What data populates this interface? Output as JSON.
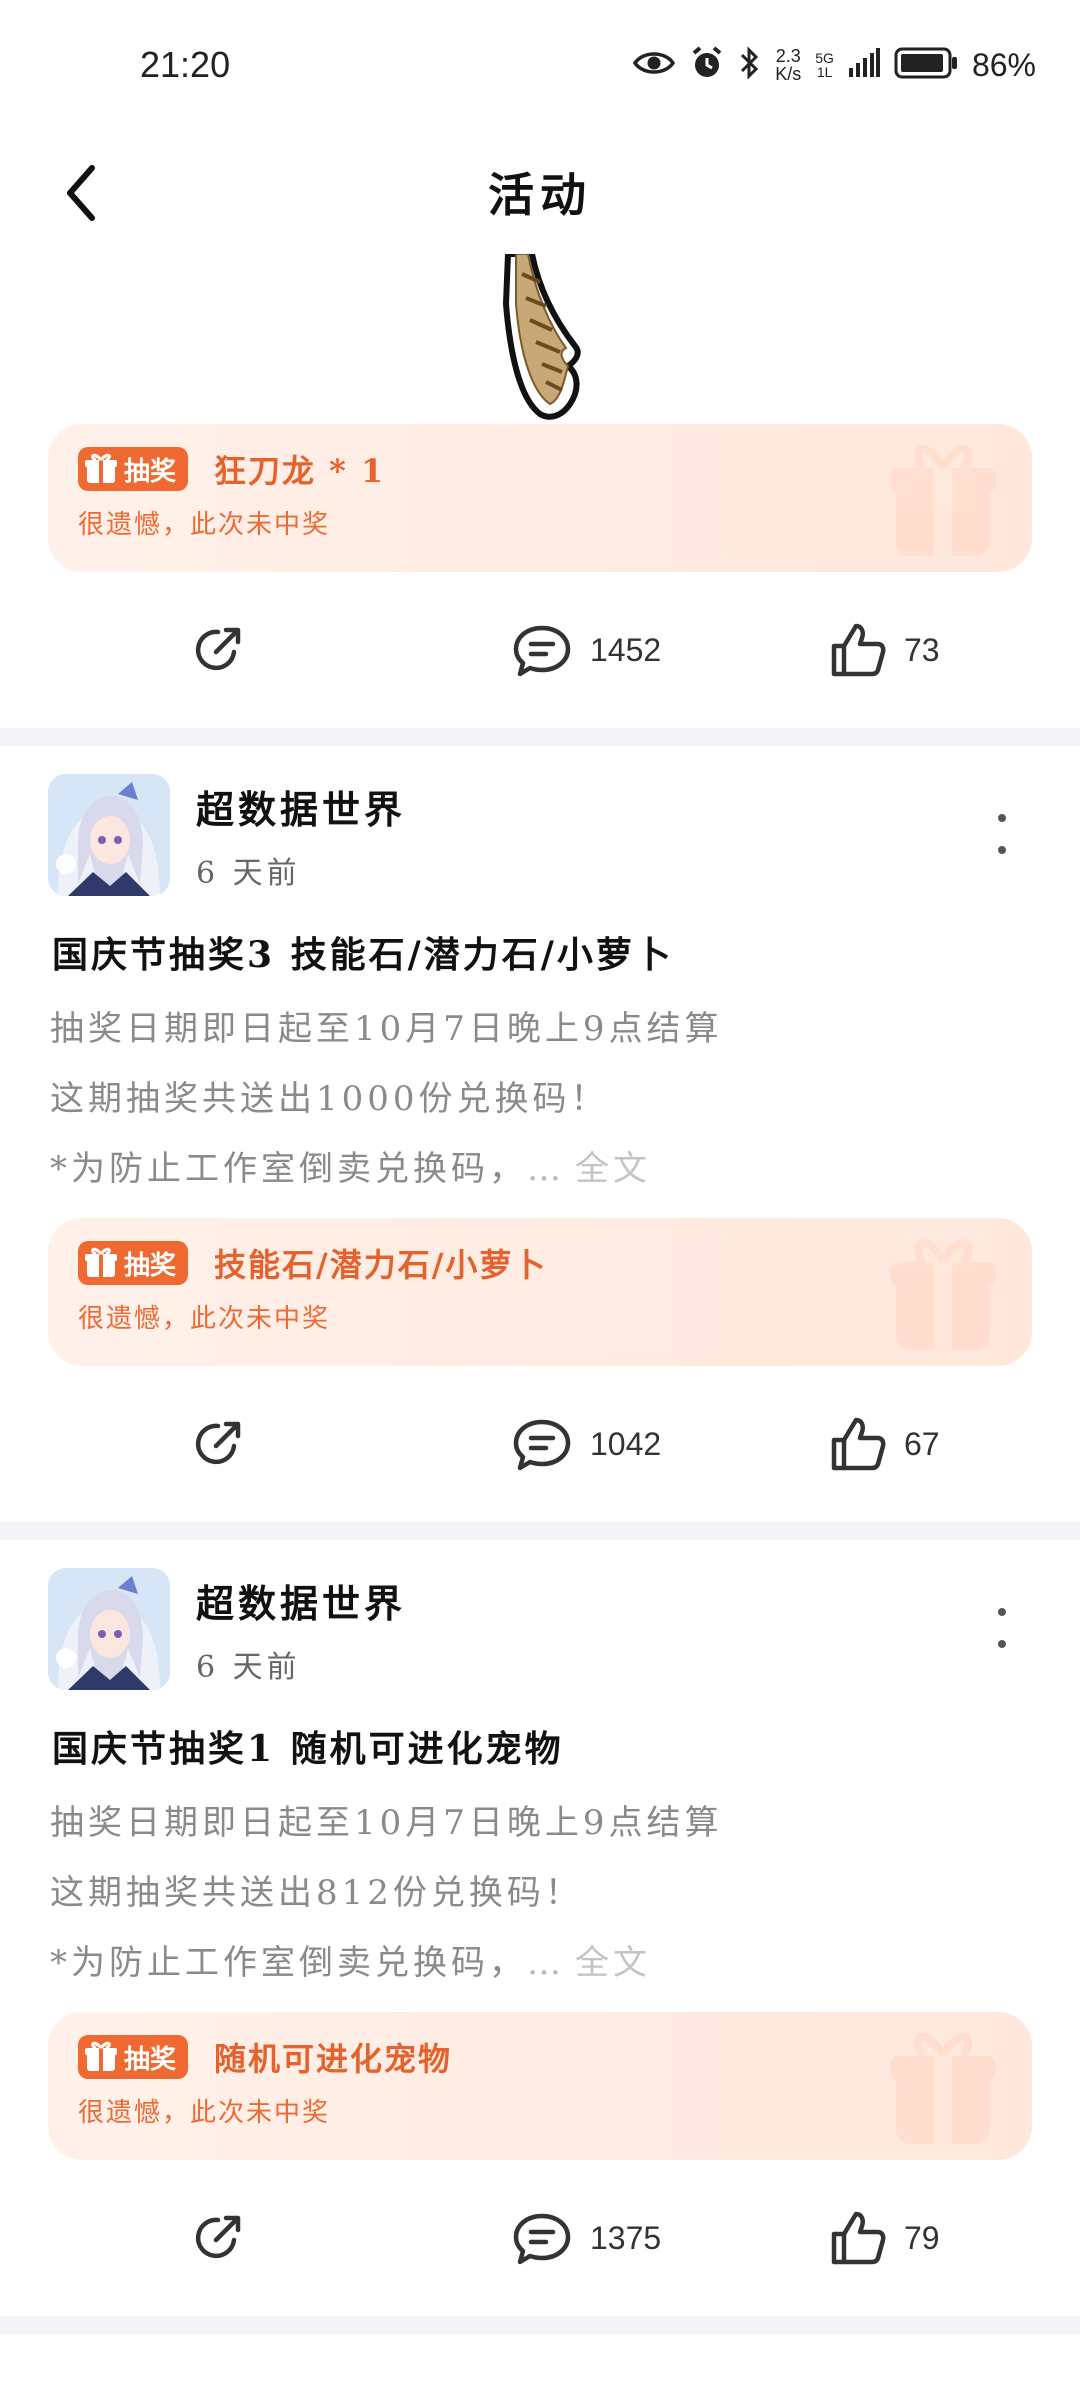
{
  "status_bar": {
    "time": "21:20",
    "net_speed_top": "2.3",
    "net_speed_bottom": "K/s",
    "signal_label_top": "5G",
    "signal_label_bottom": "1L",
    "battery": "86%"
  },
  "header": {
    "title": "活动"
  },
  "first_item": {
    "prize": {
      "badge": "抽奖",
      "name": "狂刀龙 * 1",
      "result": "很遗憾，此次未中奖"
    },
    "actions": {
      "comments": "1452",
      "likes": "73"
    }
  },
  "posts": [
    {
      "author": "超数据世界",
      "time": "6 天前",
      "title": "国庆节抽奖3 技能石/潜力石/小萝卜",
      "lines": [
        "抽奖日期即日起至10月7日晚上9点结算",
        "这期抽奖共送出1000份兑换码！",
        "*为防止工作室倒卖兑换码，"
      ],
      "ellipsis": "…",
      "read_more": "全文",
      "prize": {
        "badge": "抽奖",
        "name": "技能石/潜力石/小萝卜",
        "result": "很遗憾，此次未中奖"
      },
      "actions": {
        "comments": "1042",
        "likes": "67"
      }
    },
    {
      "author": "超数据世界",
      "time": "6 天前",
      "title": "国庆节抽奖1 随机可进化宠物",
      "lines": [
        "抽奖日期即日起至10月7日晚上9点结算",
        "这期抽奖共送出812份兑换码！",
        "*为防止工作室倒卖兑换码，"
      ],
      "ellipsis": "…",
      "read_more": "全文",
      "prize": {
        "badge": "抽奖",
        "name": "随机可进化宠物",
        "result": "很遗憾，此次未中奖"
      },
      "actions": {
        "comments": "1375",
        "likes": "79"
      }
    }
  ],
  "colors": {
    "accent": "#ef6a33",
    "prize_bg": "#ffe9df",
    "divider": "#f3f4f8"
  }
}
